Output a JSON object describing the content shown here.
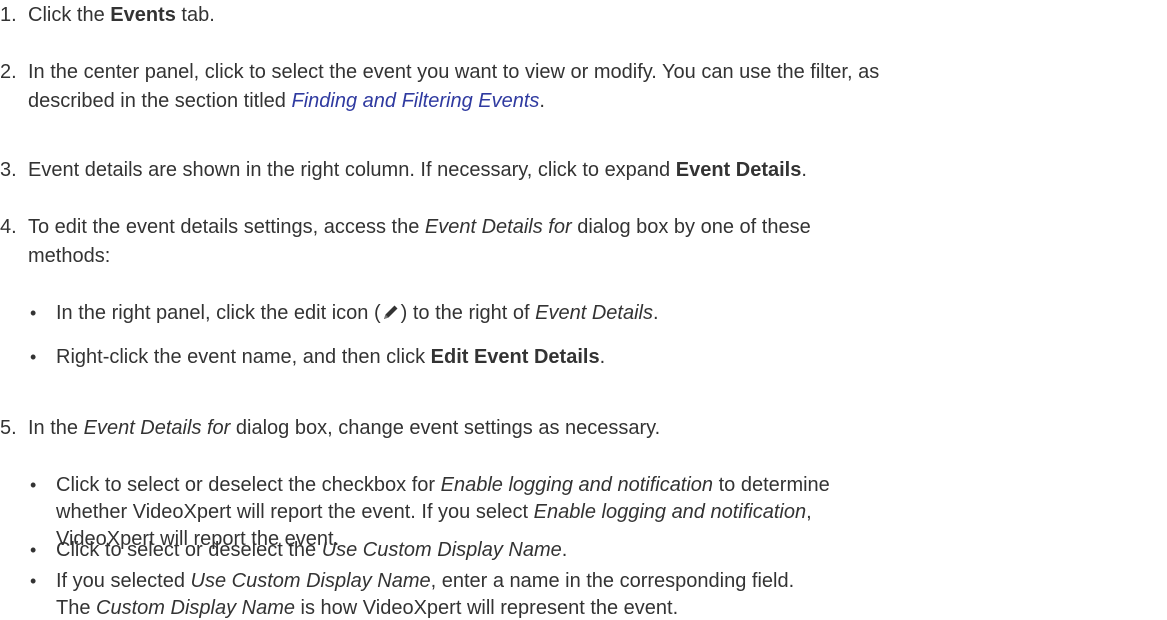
{
  "steps": [
    {
      "number": "1.",
      "line1": {
        "a": "Click the ",
        "b": "Events",
        "c": " tab."
      }
    },
    {
      "number": "2.",
      "line1": "In the center panel, click to select the event you want to view or modify. You can use the filter, as",
      "line2": {
        "a": "described in the section titled ",
        "link": "Finding and Filtering Events",
        "c": "."
      }
    },
    {
      "number": "3.",
      "line1": {
        "a": "Event details are shown in the right column. If necessary, click to expand ",
        "b": "Event Details",
        "c": "."
      }
    },
    {
      "number": "4.",
      "line1": {
        "a": "To edit the event details settings, access the ",
        "i": "Event Details for",
        "c": " dialog box by one of these"
      },
      "line2": "methods:",
      "bullets": [
        {
          "a": "In the right panel, click the edit icon (",
          "icon": "pencil-icon",
          "b": ") to the right of ",
          "i": "Event Details",
          "c": "."
        },
        {
          "a": "Right-click the event name, and then click ",
          "b": "Edit Event Details",
          "c": "."
        }
      ]
    },
    {
      "number": "5.",
      "line1": {
        "a": "In the ",
        "i": "Event Details for",
        "c": " dialog box, change event settings as necessary."
      },
      "bullets": [
        {
          "line1": {
            "a": "Click to select or deselect the checkbox for ",
            "i": "Enable logging and notification",
            "c": " to determine"
          },
          "line2": {
            "a": "whether VideoXpert will report the event. If you select ",
            "i": "Enable logging and notification",
            "c": ","
          },
          "line3": "VideoXpert will report the event."
        },
        {
          "a": "Click to select or deselect the ",
          "i": "Use Custom Display Name",
          "c": "."
        },
        {
          "line1": {
            "a": "If you selected ",
            "i": "Use Custom Display Name",
            "c": ", enter a name in the corresponding field."
          },
          "line2": {
            "a": "The ",
            "i": "Custom Display Name",
            "c": " is how VideoXpert will represent the event."
          }
        }
      ]
    }
  ],
  "bullet_glyph": "•",
  "colors": {
    "text": "#333333",
    "link": "#2f3aa0"
  }
}
